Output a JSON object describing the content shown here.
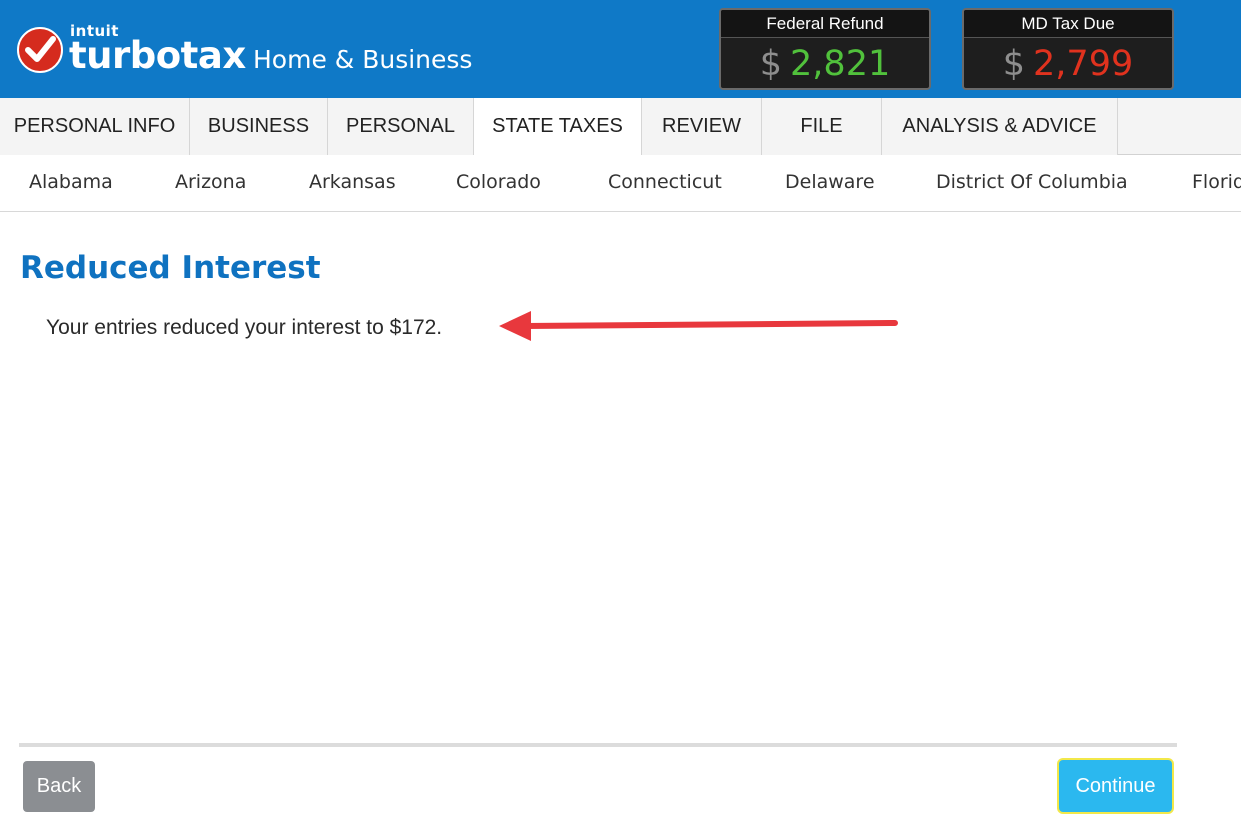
{
  "header": {
    "logo": {
      "brand": "intuit",
      "product": "turbotax",
      "edition": "Home & Business"
    },
    "federal": {
      "label": "Federal Refund",
      "currency": "$",
      "amount": "2,821",
      "color": "#51c13c"
    },
    "state": {
      "label": "MD Tax Due",
      "currency": "$",
      "amount": "2,799",
      "color": "#e0321e"
    }
  },
  "main_nav": {
    "tabs": [
      {
        "label": "PERSONAL INFO"
      },
      {
        "label": "BUSINESS"
      },
      {
        "label": "PERSONAL"
      },
      {
        "label": "STATE TAXES",
        "active": true
      },
      {
        "label": "REVIEW"
      },
      {
        "label": "FILE"
      },
      {
        "label": "ANALYSIS & ADVICE"
      }
    ]
  },
  "state_nav": {
    "items": [
      "Alabama",
      "Arizona",
      "Arkansas",
      "Colorado",
      "Connecticut",
      "Delaware",
      "District Of Columbia",
      "Florida"
    ]
  },
  "content": {
    "title": "Reduced Interest",
    "message": "Your entries reduced your interest to $172."
  },
  "footer": {
    "back_label": "Back",
    "continue_label": "Continue"
  },
  "colors": {
    "header_bg": "#0f79c7",
    "title": "#0f72c0",
    "annotation_arrow": "#e8383d",
    "continue_button": "#2bb8ef"
  }
}
